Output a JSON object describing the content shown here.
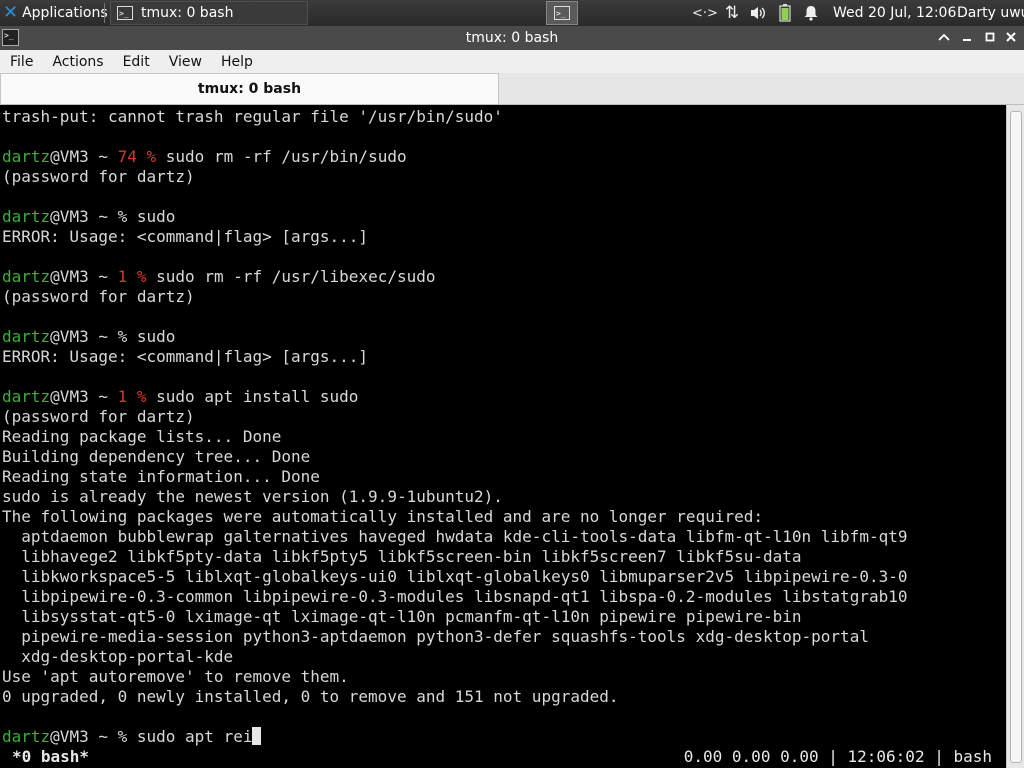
{
  "panel": {
    "apps_label": "Applications",
    "task_label": "tmux: 0 bash",
    "clock": "Wed 20 Jul, 12:06",
    "user": "Darty uwu",
    "tray_icons": [
      "network-icon",
      "transfer-icon",
      "volume-icon",
      "battery-icon",
      "notification-bell-icon"
    ]
  },
  "window": {
    "title": "tmux: 0 bash",
    "buttons": [
      "minimize-icon",
      "restore-icon",
      "maximize-icon",
      "close-icon"
    ]
  },
  "menu": [
    "File",
    "Actions",
    "Edit",
    "View",
    "Help"
  ],
  "tab": {
    "label": "tmux: 0 bash"
  },
  "terminal": {
    "lines": [
      [
        [
          "t",
          "trash-put: cannot trash regular file '/usr/bin/sudo'"
        ]
      ],
      [],
      [
        [
          "u",
          "dartz"
        ],
        [
          "t",
          "@VM3 ~ "
        ],
        [
          "r",
          "74 %"
        ],
        [
          "t",
          " sudo rm -rf /usr/bin/sudo"
        ]
      ],
      [
        [
          "t",
          "(password for dartz)"
        ]
      ],
      [],
      [
        [
          "u",
          "dartz"
        ],
        [
          "t",
          "@VM3 ~ % sudo"
        ]
      ],
      [
        [
          "t",
          "ERROR: Usage: <command|flag> [args...]"
        ]
      ],
      [],
      [
        [
          "u",
          "dartz"
        ],
        [
          "t",
          "@VM3 ~ "
        ],
        [
          "r",
          "1 %"
        ],
        [
          "t",
          " sudo rm -rf /usr/libexec/sudo"
        ]
      ],
      [
        [
          "t",
          "(password for dartz)"
        ]
      ],
      [],
      [
        [
          "u",
          "dartz"
        ],
        [
          "t",
          "@VM3 ~ % sudo"
        ]
      ],
      [
        [
          "t",
          "ERROR: Usage: <command|flag> [args...]"
        ]
      ],
      [],
      [
        [
          "u",
          "dartz"
        ],
        [
          "t",
          "@VM3 ~ "
        ],
        [
          "r",
          "1 %"
        ],
        [
          "t",
          " sudo apt install sudo"
        ]
      ],
      [
        [
          "t",
          "(password for dartz)"
        ]
      ],
      [
        [
          "t",
          "Reading package lists... Done"
        ]
      ],
      [
        [
          "t",
          "Building dependency tree... Done"
        ]
      ],
      [
        [
          "t",
          "Reading state information... Done"
        ]
      ],
      [
        [
          "t",
          "sudo is already the newest version (1.9.9-1ubuntu2)."
        ]
      ],
      [
        [
          "t",
          "The following packages were automatically installed and are no longer required:"
        ]
      ],
      [
        [
          "t",
          "  aptdaemon bubblewrap galternatives haveged hwdata kde-cli-tools-data libfm-qt-l10n libfm-qt9"
        ]
      ],
      [
        [
          "t",
          "  libhavege2 libkf5pty-data libkf5pty5 libkf5screen-bin libkf5screen7 libkf5su-data"
        ]
      ],
      [
        [
          "t",
          "  libkworkspace5-5 liblxqt-globalkeys-ui0 liblxqt-globalkeys0 libmuparser2v5 libpipewire-0.3-0"
        ]
      ],
      [
        [
          "t",
          "  libpipewire-0.3-common libpipewire-0.3-modules libsnapd-qt1 libspa-0.2-modules libstatgrab10"
        ]
      ],
      [
        [
          "t",
          "  libsysstat-qt5-0 lximage-qt lximage-qt-l10n pcmanfm-qt-l10n pipewire pipewire-bin"
        ]
      ],
      [
        [
          "t",
          "  pipewire-media-session python3-aptdaemon python3-defer squashfs-tools xdg-desktop-portal"
        ]
      ],
      [
        [
          "t",
          "  xdg-desktop-portal-kde"
        ]
      ],
      [
        [
          "t",
          "Use 'apt autoremove' to remove them."
        ]
      ],
      [
        [
          "t",
          "0 upgraded, 0 newly installed, 0 to remove and 151 not upgraded."
        ]
      ],
      [],
      [
        [
          "u",
          "dartz"
        ],
        [
          "t",
          "@VM3 ~ % sudo apt rei"
        ],
        [
          "c",
          ""
        ]
      ]
    ],
    "status_left": "*0 bash*",
    "status_right": "0.00 0.00 0.00 | 12:06:02 | bash"
  },
  "colors": {
    "prompt_user": "#3dae3b",
    "error_code": "#d43a2a",
    "text": "#d8d8d8",
    "background": "#000000"
  }
}
